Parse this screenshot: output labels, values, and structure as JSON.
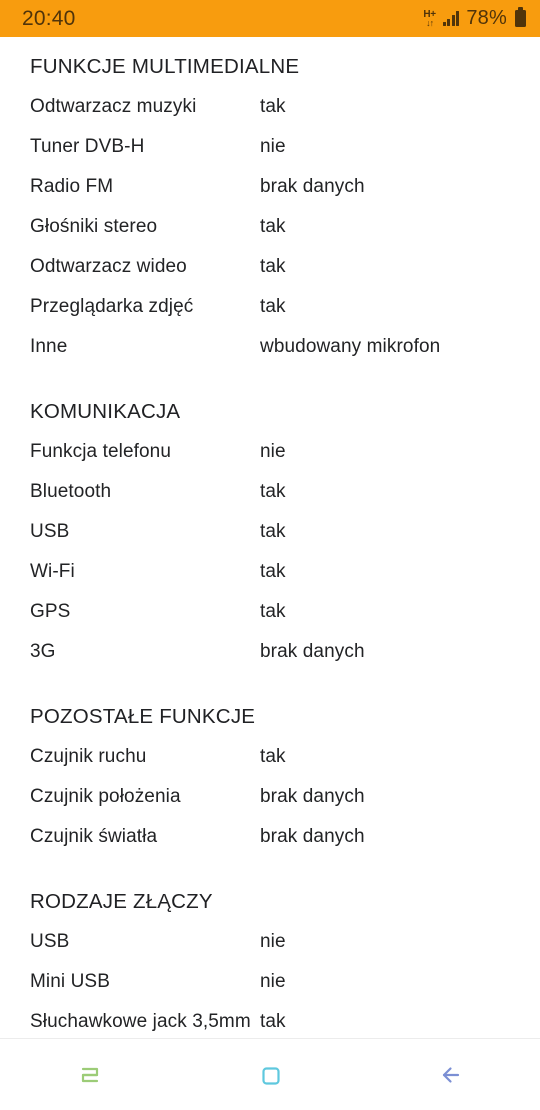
{
  "statusbar": {
    "time": "20:40",
    "network_label": "H+",
    "network_arrows": "↓↑",
    "signal_icon": "signal-bars-icon",
    "battery_percent": "78%",
    "battery_icon": "battery-icon",
    "background_color": "#f89c0e",
    "foreground_color": "#50340a"
  },
  "sections": [
    {
      "title": "FUNKCJE MULTIMEDIALNE",
      "rows": [
        {
          "label": "Odtwarzacz muzyki",
          "value": "tak"
        },
        {
          "label": "Tuner DVB-H",
          "value": "nie"
        },
        {
          "label": "Radio FM",
          "value": "brak danych"
        },
        {
          "label": "Głośniki stereo",
          "value": "tak"
        },
        {
          "label": "Odtwarzacz wideo",
          "value": "tak"
        },
        {
          "label": "Przeglądarka zdjęć",
          "value": "tak"
        },
        {
          "label": "Inne",
          "value": "wbudowany mikrofon"
        }
      ]
    },
    {
      "title": "KOMUNIKACJA",
      "rows": [
        {
          "label": "Funkcja telefonu",
          "value": "nie"
        },
        {
          "label": "Bluetooth",
          "value": "tak"
        },
        {
          "label": "USB",
          "value": "tak"
        },
        {
          "label": "Wi-Fi",
          "value": "tak"
        },
        {
          "label": "GPS",
          "value": "tak"
        },
        {
          "label": "3G",
          "value": "brak danych"
        }
      ]
    },
    {
      "title": "POZOSTAŁE FUNKCJE",
      "rows": [
        {
          "label": "Czujnik ruchu",
          "value": "tak"
        },
        {
          "label": "Czujnik położenia",
          "value": "brak danych"
        },
        {
          "label": "Czujnik światła",
          "value": "brak danych"
        }
      ]
    },
    {
      "title": "RODZAJE ZŁĄCZY",
      "rows": [
        {
          "label": "USB",
          "value": "nie"
        },
        {
          "label": "Mini USB",
          "value": "nie"
        },
        {
          "label": "Słuchawkowe jack 3,5mm",
          "value": "tak"
        }
      ]
    }
  ],
  "navbar": {
    "recents": {
      "icon": "recents-icon",
      "color": "#9ccc77"
    },
    "home": {
      "icon": "home-square-icon",
      "color": "#5ec8de"
    },
    "back": {
      "icon": "back-arrow-icon",
      "color": "#7b8fd4"
    }
  }
}
